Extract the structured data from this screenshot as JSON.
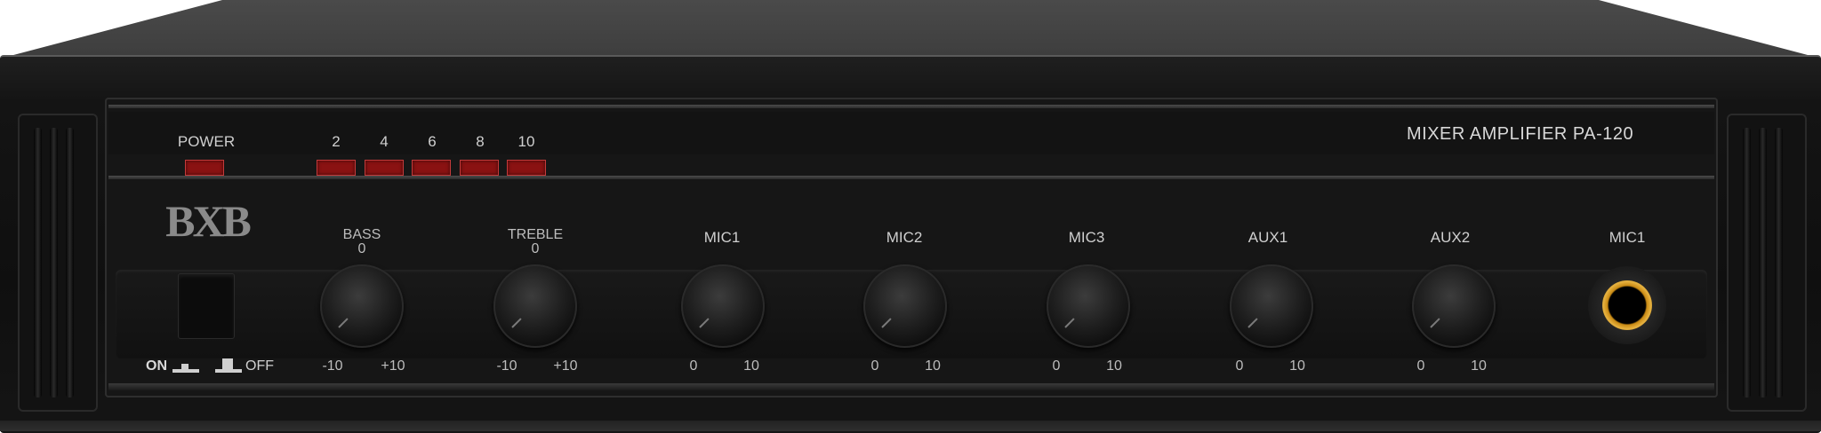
{
  "brand": {
    "logo_text": "BXB"
  },
  "model": {
    "title": "MIXER AMPLIFIER  PA-120"
  },
  "power_section": {
    "label": "POWER"
  },
  "level_meter": {
    "labels": [
      "2",
      "4",
      "6",
      "8",
      "10"
    ]
  },
  "power_switch": {
    "on_label": "ON",
    "off_label": "OFF"
  },
  "knobs": [
    {
      "name": "BASS",
      "center": "0",
      "min": "-10",
      "max": "+10"
    },
    {
      "name": "TREBLE",
      "center": "0",
      "min": "-10",
      "max": "+10"
    },
    {
      "name": "MIC1",
      "min": "0",
      "max": "10"
    },
    {
      "name": "MIC2",
      "min": "0",
      "max": "10"
    },
    {
      "name": "MIC3",
      "min": "0",
      "max": "10"
    },
    {
      "name": "AUX1",
      "min": "0",
      "max": "10"
    },
    {
      "name": "AUX2",
      "min": "0",
      "max": "10"
    }
  ],
  "mic_input": {
    "label": "MIC1"
  },
  "colors": {
    "led_red": "#8a1212",
    "jack_ring": "#e7b341",
    "panel": "#161616"
  }
}
